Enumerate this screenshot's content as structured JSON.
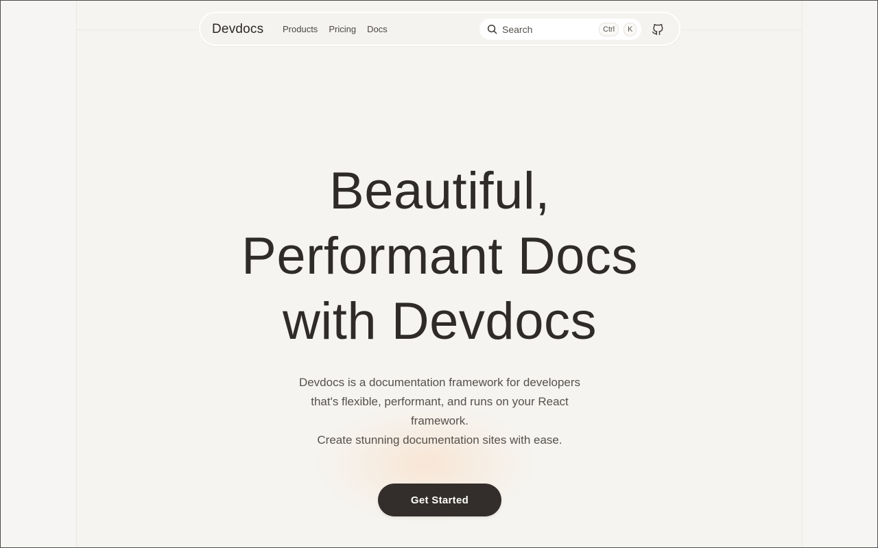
{
  "nav": {
    "brand": "Devdocs",
    "links": [
      {
        "label": "Products"
      },
      {
        "label": "Pricing"
      },
      {
        "label": "Docs"
      }
    ],
    "search": {
      "placeholder": "Search",
      "shortcut_keys": [
        "Ctrl",
        "K"
      ],
      "icon": "search-icon"
    },
    "github_icon": "github-icon"
  },
  "hero": {
    "title_lines": [
      "Beautiful,",
      "Performant Docs",
      "with Devdocs"
    ],
    "description_lines": [
      "Devdocs is a documentation framework for developers",
      "that's flexible, performant, and runs on your React",
      "framework.",
      "Create stunning documentation sites with ease."
    ],
    "cta_label": "Get Started"
  },
  "colors": {
    "background": "#f6f5f3",
    "text": "#2f2b29",
    "button": "#332e2b",
    "button_text": "#ffffff",
    "glow": "#fadabe"
  }
}
